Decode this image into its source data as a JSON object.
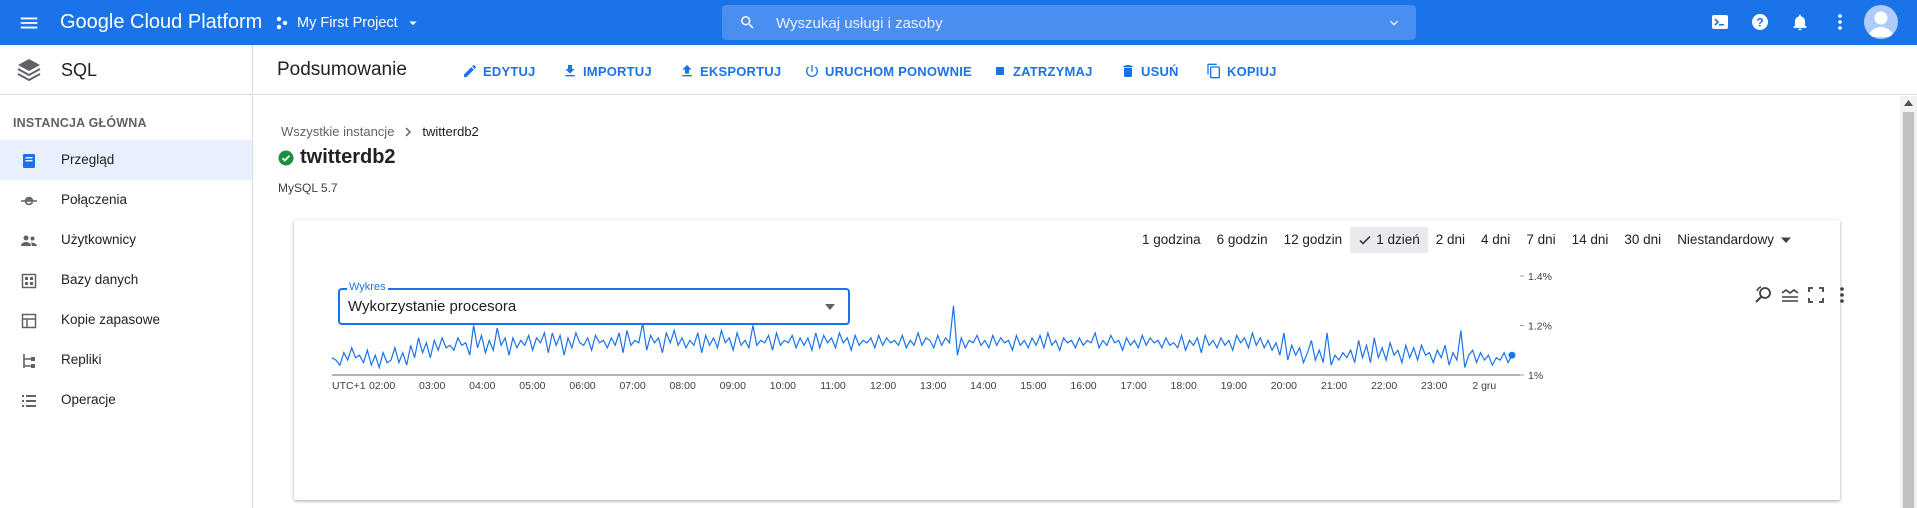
{
  "topbar": {
    "brand": "Google Cloud Platform",
    "project": "My First Project",
    "search_placeholder": "Wyszukaj usługi i zasoby"
  },
  "subheader": {
    "product": "SQL",
    "title": "Podsumowanie",
    "actions": [
      "EDYTUJ",
      "IMPORTUJ",
      "EKSPORTUJ",
      "URUCHOM PONOWNIE",
      "ZATRZYMAJ",
      "USUŃ",
      "KOPIUJ"
    ]
  },
  "sidebar": {
    "section": "INSTANCJA GŁÓWNA",
    "items": [
      {
        "label": "Przegląd",
        "icon": "overview-icon",
        "active": true
      },
      {
        "label": "Połączenia",
        "icon": "connections-icon",
        "active": false
      },
      {
        "label": "Użytkownicy",
        "icon": "users-icon",
        "active": false
      },
      {
        "label": "Bazy danych",
        "icon": "databases-icon",
        "active": false
      },
      {
        "label": "Kopie zapasowe",
        "icon": "backups-icon",
        "active": false
      },
      {
        "label": "Repliki",
        "icon": "replicas-icon",
        "active": false
      },
      {
        "label": "Operacje",
        "icon": "operations-icon",
        "active": false
      }
    ]
  },
  "breadcrumb": {
    "root": "Wszystkie instancje",
    "current": "twitterdb2"
  },
  "instance": {
    "name": "twitterdb2",
    "version": "MySQL 5.7",
    "status": "running"
  },
  "time_ranges": {
    "options": [
      "1 godzina",
      "6 godzin",
      "12 godzin",
      "1 dzień",
      "2 dni",
      "4 dni",
      "7 dni",
      "14 dni",
      "30 dni"
    ],
    "selected": "1 dzień",
    "custom": "Niestandardowy"
  },
  "chart_select": {
    "label": "Wykres",
    "value": "Wykorzystanie procesora"
  },
  "colors": {
    "accent": "#1a73e8",
    "line": "#1a73e8",
    "status_ok": "#1e8e3e"
  },
  "chart_data": {
    "type": "line",
    "title": "Wykorzystanie procesora",
    "x_ticks": [
      "UTC+1",
      "02:00",
      "03:00",
      "04:00",
      "05:00",
      "06:00",
      "07:00",
      "08:00",
      "09:00",
      "10:00",
      "11:00",
      "12:00",
      "13:00",
      "14:00",
      "15:00",
      "16:00",
      "17:00",
      "18:00",
      "19:00",
      "20:00",
      "21:00",
      "22:00",
      "23:00",
      "2 gru"
    ],
    "y_ticks": [
      "1.4%",
      "1.2%",
      "1%"
    ],
    "ylim": [
      1.0,
      1.4
    ],
    "grid": false,
    "series": [
      {
        "unit": "%",
        "values": [
          1.07,
          1.06,
          1.04,
          1.09,
          1.06,
          1.11,
          1.07,
          1.08,
          1.05,
          1.1,
          1.04,
          1.08,
          1.03,
          1.09,
          1.05,
          1.06,
          1.11,
          1.05,
          1.09,
          1.04,
          1.12,
          1.07,
          1.15,
          1.09,
          1.13,
          1.07,
          1.14,
          1.1,
          1.15,
          1.11,
          1.12,
          1.1,
          1.15,
          1.12,
          1.13,
          1.08,
          1.2,
          1.11,
          1.16,
          1.09,
          1.14,
          1.1,
          1.19,
          1.12,
          1.15,
          1.08,
          1.15,
          1.11,
          1.14,
          1.12,
          1.16,
          1.1,
          1.15,
          1.13,
          1.17,
          1.09,
          1.17,
          1.12,
          1.16,
          1.08,
          1.15,
          1.11,
          1.17,
          1.13,
          1.12,
          1.15,
          1.1,
          1.16,
          1.13,
          1.14,
          1.11,
          1.15,
          1.12,
          1.17,
          1.09,
          1.18,
          1.12,
          1.14,
          1.13,
          1.21,
          1.1,
          1.16,
          1.13,
          1.15,
          1.09,
          1.17,
          1.13,
          1.18,
          1.12,
          1.15,
          1.11,
          1.14,
          1.12,
          1.17,
          1.09,
          1.16,
          1.12,
          1.15,
          1.11,
          1.18,
          1.13,
          1.15,
          1.1,
          1.17,
          1.12,
          1.14,
          1.11,
          1.2,
          1.12,
          1.14,
          1.13,
          1.16,
          1.1,
          1.17,
          1.12,
          1.14,
          1.13,
          1.16,
          1.11,
          1.15,
          1.12,
          1.15,
          1.1,
          1.17,
          1.11,
          1.16,
          1.13,
          1.15,
          1.11,
          1.17,
          1.13,
          1.15,
          1.1,
          1.16,
          1.12,
          1.14,
          1.13,
          1.15,
          1.11,
          1.16,
          1.12,
          1.15,
          1.13,
          1.14,
          1.12,
          1.16,
          1.11,
          1.14,
          1.12,
          1.17,
          1.12,
          1.15,
          1.14,
          1.11,
          1.16,
          1.12,
          1.15,
          1.13,
          1.28,
          1.08,
          1.15,
          1.11,
          1.14,
          1.13,
          1.16,
          1.12,
          1.14,
          1.11,
          1.16,
          1.12,
          1.15,
          1.13,
          1.14,
          1.1,
          1.16,
          1.12,
          1.14,
          1.11,
          1.15,
          1.12,
          1.16,
          1.11,
          1.17,
          1.12,
          1.14,
          1.1,
          1.15,
          1.13,
          1.14,
          1.11,
          1.15,
          1.12,
          1.14,
          1.13,
          1.17,
          1.11,
          1.14,
          1.12,
          1.16,
          1.13,
          1.14,
          1.1,
          1.15,
          1.12,
          1.14,
          1.11,
          1.16,
          1.12,
          1.15,
          1.13,
          1.14,
          1.11,
          1.15,
          1.12,
          1.13,
          1.11,
          1.16,
          1.1,
          1.14,
          1.12,
          1.15,
          1.09,
          1.16,
          1.12,
          1.14,
          1.11,
          1.15,
          1.12,
          1.14,
          1.1,
          1.16,
          1.13,
          1.15,
          1.11,
          1.17,
          1.12,
          1.15,
          1.11,
          1.14,
          1.1,
          1.13,
          1.08,
          1.17,
          1.06,
          1.12,
          1.08,
          1.11,
          1.05,
          1.09,
          1.14,
          1.06,
          1.1,
          1.05,
          1.17,
          1.04,
          1.08,
          1.06,
          1.09,
          1.07,
          1.1,
          1.05,
          1.14,
          1.07,
          1.12,
          1.05,
          1.15,
          1.07,
          1.11,
          1.06,
          1.13,
          1.08,
          1.1,
          1.05,
          1.12,
          1.07,
          1.11,
          1.06,
          1.12,
          1.08,
          1.09,
          1.05,
          1.1,
          1.07,
          1.12,
          1.04,
          1.09,
          1.06,
          1.18,
          1.03,
          1.08,
          1.1,
          1.05,
          1.09,
          1.06,
          1.08,
          1.04,
          1.07,
          1.06,
          1.09,
          1.05,
          1.08
        ]
      }
    ]
  }
}
